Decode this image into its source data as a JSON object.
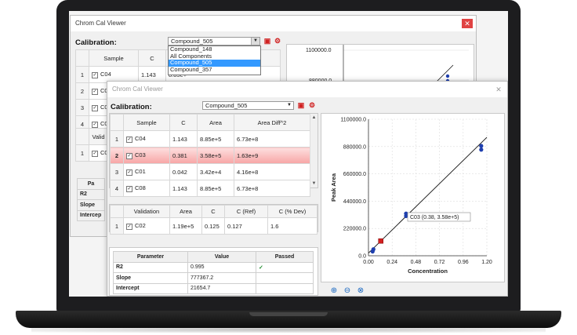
{
  "back_window": {
    "title": "Chrom Cal Viewer",
    "close": "✕",
    "calibration_label": "Calibration:",
    "combo_value": "Compound_505",
    "dropdown_items": [
      "Compound_148",
      "All Components",
      "Compound_505",
      "Compound_357"
    ],
    "dropdown_selected": "Compound_505",
    "table": {
      "headers": [
        "",
        "Sample",
        "C",
        "Area"
      ],
      "rows": [
        {
          "num": "1",
          "sample": "C04",
          "c": "1.143",
          "area": "8.85e+"
        },
        {
          "num": "2",
          "sample": "C03",
          "c": "",
          "area": ""
        },
        {
          "num": "3",
          "sample": "C01",
          "c": "",
          "area": ""
        },
        {
          "num": "4",
          "sample": "C08",
          "c": "",
          "area": ""
        }
      ]
    },
    "validation": {
      "header": "Valid",
      "row_num": "1",
      "sample": "C02"
    },
    "params": {
      "header": "Pa",
      "rows": [
        "R2",
        "Slope",
        "Intercep"
      ]
    },
    "chart_ticks": [
      "1100000.0",
      "880000.0"
    ]
  },
  "front_window": {
    "title": "Chrom Cal Viewer",
    "close": "✕",
    "calibration_label": "Calibration:",
    "combo_value": "Compound_505",
    "samples": {
      "headers": [
        "Sample",
        "C",
        "Area",
        "Area Diff^2"
      ],
      "rows": [
        {
          "num": "1",
          "sample": "C04",
          "c": "1.143",
          "area": "8.85e+5",
          "diff": "6.73e+8",
          "highlight": false
        },
        {
          "num": "2",
          "sample": "C03",
          "c": "0.381",
          "area": "3.58e+5",
          "diff": "1.63e+9",
          "highlight": true
        },
        {
          "num": "3",
          "sample": "C01",
          "c": "0.042",
          "area": "3.42e+4",
          "diff": "4.16e+8",
          "highlight": false
        },
        {
          "num": "4",
          "sample": "C08",
          "c": "1.143",
          "area": "8.85e+5",
          "diff": "6.73e+8",
          "highlight": false
        }
      ]
    },
    "validation": {
      "headers": [
        "Validation",
        "Area",
        "C",
        "C (Ref)",
        "C (% Dev)"
      ],
      "rows": [
        {
          "num": "1",
          "sample": "C02",
          "area": "1.19e+5",
          "c": "0.125",
          "cref": "0.127",
          "dev": "1.6"
        }
      ]
    },
    "parameters": {
      "headers": [
        "Parameter",
        "Value",
        "Passed"
      ],
      "rows": [
        {
          "name": "R2",
          "value": "0.995",
          "passed": "✓"
        },
        {
          "name": "Slope",
          "value": "777367.2",
          "passed": ""
        },
        {
          "name": "Intercept",
          "value": "21654.7",
          "passed": ""
        }
      ]
    },
    "zoom_icons": [
      "zoom-in-icon",
      "zoom-out-icon",
      "zoom-fit-icon"
    ]
  },
  "chart_data": {
    "type": "scatter",
    "title": "",
    "xlabel": "Concentration",
    "ylabel": "Peak Area",
    "xlim": [
      0.0,
      1.2
    ],
    "ylim": [
      0.0,
      1100000.0
    ],
    "x_ticks": [
      "0.00",
      "0.24",
      "0.48",
      "0.72",
      "0.96",
      "1.20"
    ],
    "y_ticks": [
      "0.0",
      "220000.0",
      "440000.0",
      "660000.0",
      "880000.0",
      "1100000.0"
    ],
    "points": [
      {
        "x": 0.042,
        "y": 34200
      },
      {
        "x": 0.05,
        "y": 52000
      },
      {
        "x": 0.381,
        "y": 320000
      },
      {
        "x": 0.381,
        "y": 340000
      },
      {
        "x": 1.143,
        "y": 855000
      },
      {
        "x": 1.143,
        "y": 885000
      }
    ],
    "selected_point": {
      "x": 0.125,
      "y": 119000
    },
    "fit_line": {
      "slope": 777367.2,
      "intercept": 21654.7
    },
    "tooltip": "C03 (0.38, 3.58e+5)",
    "point_color": "#1f3fae",
    "selected_color": "#d32020",
    "grid": true
  }
}
